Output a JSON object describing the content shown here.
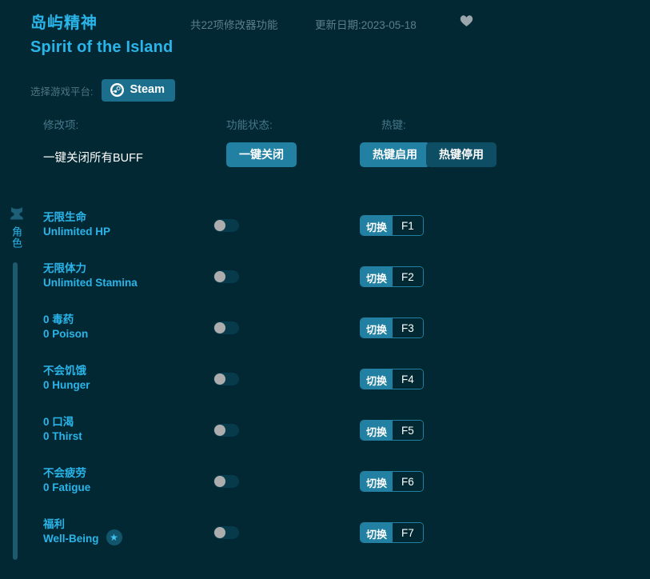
{
  "header": {
    "title_cn": "岛屿精神",
    "title_en": "Spirit of the Island",
    "feature_count": "共22项修改器功能",
    "update_date": "更新日期:2023-05-18",
    "favorite_icon": "heart-icon",
    "platform_label": "选择游戏平台:",
    "platform_button": "Steam",
    "platform_icon": "steam-icon"
  },
  "columns": {
    "modifier": "修改项:",
    "state": "功能状态:",
    "hotkey": "热键:"
  },
  "global_row": {
    "label": "一键关闭所有BUFF",
    "close_all_button": "一键关闭",
    "hotkey_enable_button": "热键启用",
    "hotkey_disable_button": "热键停用"
  },
  "sidebar": {
    "category_icon": "character-icon",
    "category_label": "角色",
    "scrollbar": "vertical-scrollbar"
  },
  "modifiers": [
    {
      "cn": "无限生命",
      "en": "Unlimited HP",
      "action": "切换",
      "key": "F1",
      "toggle": "off",
      "badge": null
    },
    {
      "cn": "无限体力",
      "en": "Unlimited Stamina",
      "action": "切换",
      "key": "F2",
      "toggle": "off",
      "badge": null
    },
    {
      "cn": "0 毒药",
      "en": "0 Poison",
      "action": "切换",
      "key": "F3",
      "toggle": "off",
      "badge": null
    },
    {
      "cn": "不会饥饿",
      "en": "0 Hunger",
      "action": "切换",
      "key": "F4",
      "toggle": "off",
      "badge": null
    },
    {
      "cn": "0 口渴",
      "en": "0 Thirst",
      "action": "切换",
      "key": "F5",
      "toggle": "off",
      "badge": null
    },
    {
      "cn": "不会疲劳",
      "en": "0 Fatigue",
      "action": "切换",
      "key": "F6",
      "toggle": "off",
      "badge": null
    },
    {
      "cn": "福利",
      "en": "Well-Being",
      "action": "切换",
      "key": "F7",
      "toggle": "off",
      "badge": "★"
    }
  ],
  "colors": {
    "background": "#012833",
    "accent_cyan": "#2ab5ea",
    "button_teal": "#2280a2",
    "button_teal_dim": "#0d4e64",
    "muted_text": "#4d7683",
    "white": "#ffffff",
    "toggle_knob": "#adadad",
    "heart_gray": "#9aa6ab"
  }
}
